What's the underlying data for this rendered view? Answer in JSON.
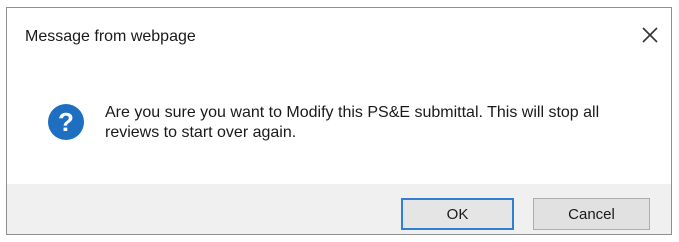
{
  "dialog": {
    "title": "Message from webpage",
    "close_icon": "close-icon",
    "message_icon": "question-icon",
    "message_icon_color": "#1e6fc1",
    "message": "Are you sure you want to Modify this PS&E submittal. This will stop all reviews to start over again.",
    "ok_label": "OK",
    "cancel_label": "Cancel",
    "default_button_border": "#2f7fd6"
  }
}
